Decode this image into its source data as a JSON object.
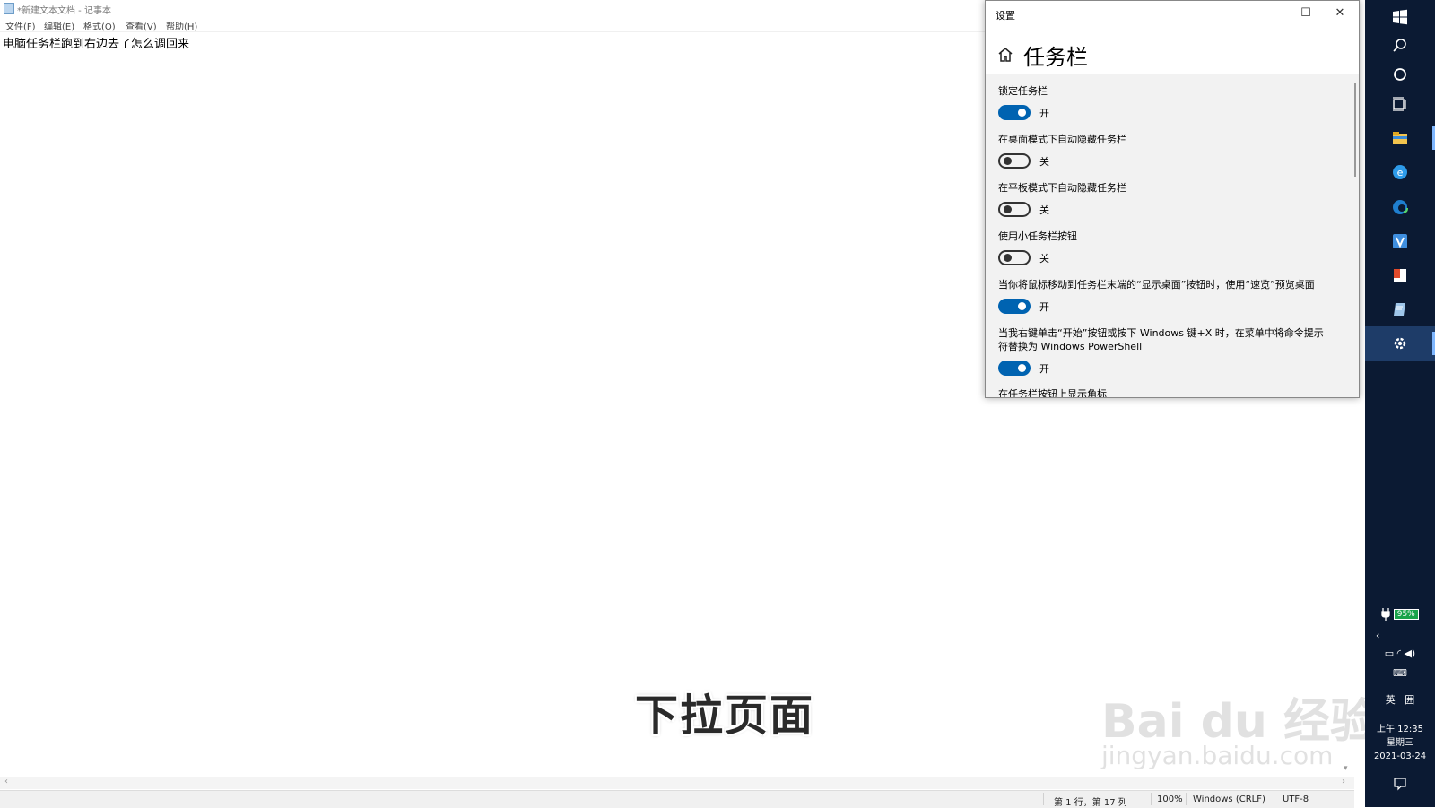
{
  "notepad": {
    "title": "*新建文本文档 - 记事本",
    "menu": [
      "文件(F)",
      "编辑(E)",
      "格式(O)",
      "查看(V)",
      "帮助(H)"
    ],
    "content": "电脑任务栏跑到右边去了怎么调回来",
    "status": {
      "position": "第 1 行，第 17 列",
      "zoom": "100%",
      "line_ending": "Windows (CRLF)",
      "encoding": "UTF-8"
    }
  },
  "subtitle": "下拉页面",
  "watermark": {
    "line1": "Bai du 经验",
    "line2": "jingyan.baidu.com"
  },
  "settings": {
    "window_title": "设置",
    "page_title": "任务栏",
    "options": [
      {
        "label": "锁定任务栏",
        "state": "开",
        "on": true
      },
      {
        "label": "在桌面模式下自动隐藏任务栏",
        "state": "关",
        "on": false
      },
      {
        "label": "在平板模式下自动隐藏任务栏",
        "state": "关",
        "on": false
      },
      {
        "label": "使用小任务栏按钮",
        "state": "关",
        "on": false
      },
      {
        "label": "当你将鼠标移动到任务栏末端的“显示桌面”按钮时，使用“速览”预览桌面",
        "state": "开",
        "on": true
      },
      {
        "label": "当我右键单击“开始”按钮或按下 Windows 键+X 时，在菜单中将命令提示符替换为 Windows PowerShell",
        "state": "开",
        "on": true
      }
    ],
    "partial_label": "在任务栏按钮上显示角标"
  },
  "taskbar": {
    "battery": "95%",
    "ime_lang": "英",
    "ime_mode": "囲",
    "time": "上午 12:35",
    "weekday": "星期三",
    "date": "2021-03-24"
  }
}
